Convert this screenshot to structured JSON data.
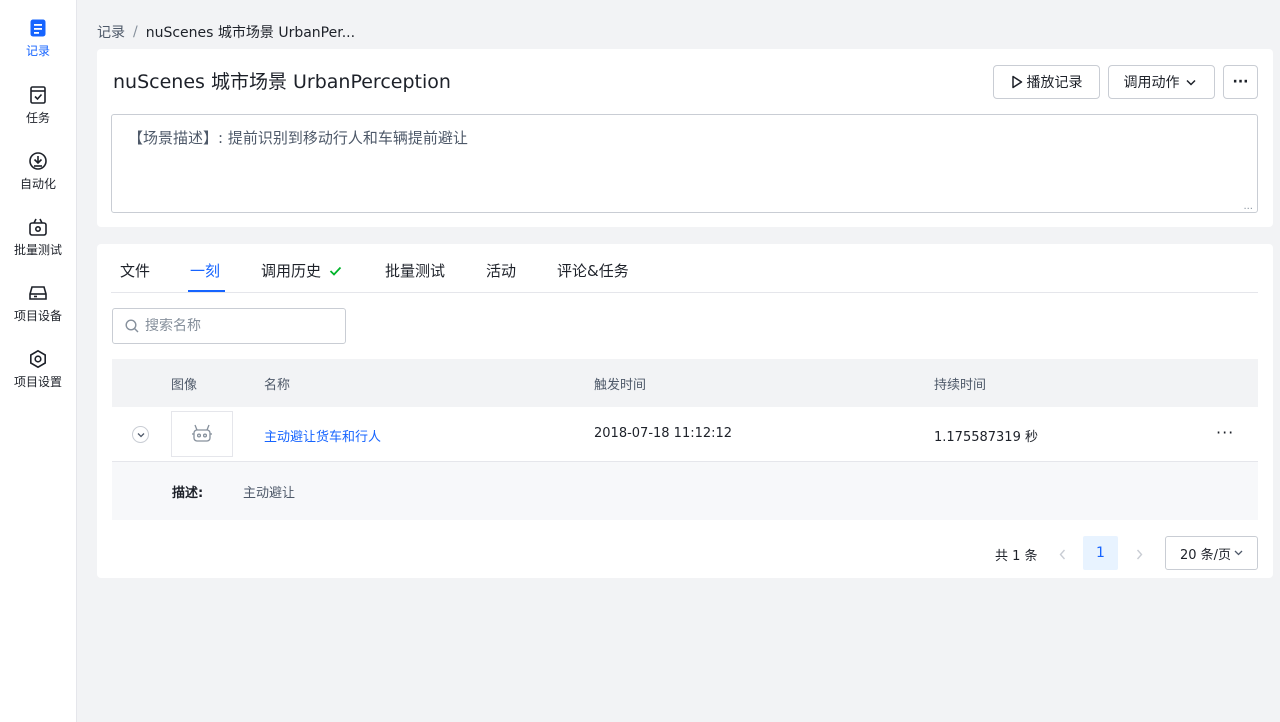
{
  "sidebar": {
    "items": [
      {
        "label": "记录",
        "icon": "document-icon",
        "active": true
      },
      {
        "label": "任务",
        "icon": "task-icon",
        "active": false
      },
      {
        "label": "自动化",
        "icon": "automation-icon",
        "active": false
      },
      {
        "label": "批量测试",
        "icon": "batch-test-icon",
        "active": false
      },
      {
        "label": "项目设备",
        "icon": "device-icon",
        "active": false
      },
      {
        "label": "项目设置",
        "icon": "gear-icon",
        "active": false
      }
    ]
  },
  "breadcrumb": {
    "parent": "记录",
    "separator": "/",
    "current": "nuScenes 城市场景 UrbanPer..."
  },
  "header": {
    "title": "nuScenes 城市场景 UrbanPerception",
    "play_label": "播放记录",
    "action_label": "调用动作",
    "more_label": "···",
    "description": "【场景描述】: 提前识别到移动行人和车辆提前避让",
    "resize_glyph": "..."
  },
  "tabs": [
    {
      "label": "文件"
    },
    {
      "label": "一刻",
      "active": true
    },
    {
      "label": "调用历史",
      "status": "check"
    },
    {
      "label": "批量测试"
    },
    {
      "label": "活动"
    },
    {
      "label": "评论&任务"
    }
  ],
  "search": {
    "placeholder": "搜索名称",
    "value": ""
  },
  "table": {
    "columns": [
      "图像",
      "名称",
      "触发时间",
      "持续时间"
    ],
    "rows": [
      {
        "name": "主动避让货车和行人",
        "trigger_time": "2018-07-18 11:12:12",
        "duration": "1.175587319 秒",
        "more": "···",
        "detail_label": "描述:",
        "detail_value": "主动避让"
      }
    ]
  },
  "pagination": {
    "total": "共 1 条",
    "current_page": "1",
    "page_size": "20 条/页"
  },
  "colors": {
    "accent": "#1664ff",
    "success": "#00b42a",
    "border": "#c9cdd4",
    "bg": "#f2f3f5"
  }
}
